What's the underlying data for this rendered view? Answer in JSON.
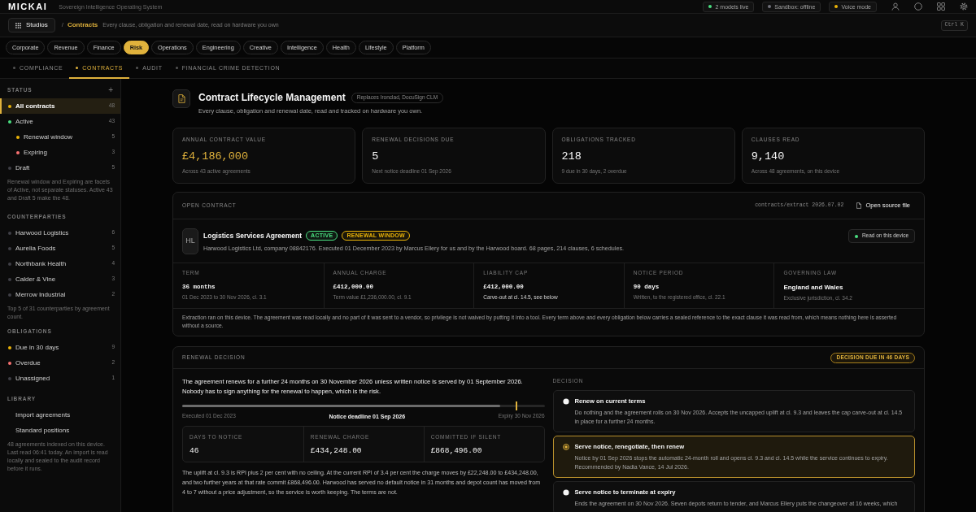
{
  "top_bar": {
    "logo": "MICKAI",
    "tagline": "Sovereign Intelligence Operating System",
    "status_pills": [
      {
        "label": "2 models live",
        "color": "#4ade80"
      },
      {
        "label": "Sandbox: offline",
        "color": "#71717a"
      },
      {
        "label": "Voice mode",
        "color": "#eab308"
      }
    ]
  },
  "breadcrumb": {
    "studios_button": "Studios",
    "separator": "/",
    "current": "Contracts",
    "description": "Every clause, obligation and renewal date, read on hardware you own",
    "shortcut": "Ctrl K"
  },
  "studios": [
    {
      "label": "Corporate",
      "selected": false
    },
    {
      "label": "Revenue",
      "selected": false
    },
    {
      "label": "Finance",
      "selected": false
    },
    {
      "label": "Risk",
      "selected": true
    },
    {
      "label": "Operations",
      "selected": false
    },
    {
      "label": "Engineering",
      "selected": false
    },
    {
      "label": "Creative",
      "selected": false
    },
    {
      "label": "Intelligence",
      "selected": false
    },
    {
      "label": "Health",
      "selected": false
    },
    {
      "label": "Lifestyle",
      "selected": false
    },
    {
      "label": "Platform",
      "selected": false
    }
  ],
  "tabs": [
    {
      "label": "COMPLIANCE",
      "selected": false
    },
    {
      "label": "CONTRACTS",
      "selected": true
    },
    {
      "label": "AUDIT",
      "selected": false
    },
    {
      "label": "FINANCIAL CRIME DETECTION",
      "selected": false
    }
  ],
  "sidebar": {
    "sections": [
      {
        "title": "STATUS",
        "add_button": "+",
        "items": [
          {
            "label": "All contracts",
            "count": "48",
            "color": "#eab308",
            "selected": true
          },
          {
            "label": "Active",
            "count": "43",
            "color": "#4ade80",
            "selected": false,
            "children": [
              {
                "label": "Renewal window",
                "count": "5",
                "color": "#eab308",
                "selected": false
              },
              {
                "label": "Expiring",
                "count": "3",
                "color": "#f87171",
                "selected": false
              }
            ]
          },
          {
            "label": "Draft",
            "count": "5",
            "color": "#3f3f46",
            "selected": false
          }
        ],
        "note": "Renewal window and Expiring are facets of Active, not separate statuses. Active 43 and Draft 5 make the 48."
      },
      {
        "title": "COUNTERPARTIES",
        "items": [
          {
            "label": "Harwood Logistics",
            "count": "6",
            "color": "#3f3f46",
            "selected": false
          },
          {
            "label": "Aurelia Foods",
            "count": "5",
            "color": "#3f3f46",
            "selected": false
          },
          {
            "label": "Northbank Health",
            "count": "4",
            "color": "#3f3f46",
            "selected": false
          },
          {
            "label": "Calder & Vine",
            "count": "3",
            "color": "#3f3f46",
            "selected": false
          },
          {
            "label": "Merrow Industrial",
            "count": "2",
            "color": "#3f3f46",
            "selected": false
          }
        ],
        "note": "Top 5 of 31 counterparties by agreement count."
      },
      {
        "title": "OBLIGATIONS",
        "items": [
          {
            "label": "Due in 30 days",
            "count": "9",
            "color": "#eab308",
            "selected": false
          },
          {
            "label": "Overdue",
            "count": "2",
            "color": "#f87171",
            "selected": false
          },
          {
            "label": "Unassigned",
            "count": "1",
            "color": "#3f3f46",
            "selected": false
          }
        ]
      },
      {
        "title": "LIBRARY",
        "items": [
          {
            "label": "Import agreements",
            "selected": false
          },
          {
            "label": "Standard positions",
            "selected": false
          }
        ],
        "note": "48 agreements indexed on this device. Last read 06:41 today. An import is read locally and sealed to the audit record before it runs."
      }
    ]
  },
  "header": {
    "title": "Contract Lifecycle Management",
    "badge": "Replaces Ironclad, DocuSign CLM",
    "subtitle": "Every clause, obligation and renewal date, read and tracked on hardware you own."
  },
  "stats": [
    {
      "label": "ANNUAL CONTRACT VALUE",
      "value": "£4,186,000",
      "note": "Across 43 active agreements",
      "highlight": true
    },
    {
      "label": "RENEWAL DECISIONS DUE",
      "value": "5",
      "note": "Next notice deadline 01 Sep 2026",
      "highlight": false
    },
    {
      "label": "OBLIGATIONS TRACKED",
      "value": "218",
      "note": "9 due in 30 days, 2 overdue",
      "highlight": false
    },
    {
      "label": "CLAUSES READ",
      "value": "9,140",
      "note": "Across 48 agreements, on this device",
      "highlight": false
    }
  ],
  "open_contract": {
    "title": "OPEN CONTRACT",
    "source": "contracts/extract 2026.07.02",
    "open_button": "Open source file",
    "avatar": "HL",
    "name": "Logistics Services Agreement",
    "badges": [
      {
        "label": "ACTIVE",
        "color": "#4ade80"
      },
      {
        "label": "RENEWAL WINDOW",
        "color": "#eab308"
      }
    ],
    "description": "Harwood Logistics Ltd, company 08842176. Executed 01 December 2023 by Marcus Ellery for us and by the Harwood board. 68 pages, 214 clauses, 6 schedules.",
    "device_status": "Read on this device",
    "terms": [
      {
        "label": "TERM",
        "value": "36 months",
        "note": "01 Dec 2023 to 30 Nov 2026, cl. 3.1",
        "kind": "figure",
        "flagged": false
      },
      {
        "label": "ANNUAL CHARGE",
        "value": "£412,000.00",
        "note": "Term value £1,236,000.00, cl. 9.1",
        "kind": "figure",
        "flagged": false
      },
      {
        "label": "LIABILITY CAP",
        "value": "£412,000.00",
        "note": "Carve-out at cl. 14.5, see below",
        "kind": "figure",
        "flagged": true
      },
      {
        "label": "NOTICE PERIOD",
        "value": "90 days",
        "note": "Written, to the registered office, cl. 22.1",
        "kind": "figure",
        "flagged": false
      },
      {
        "label": "GOVERNING LAW",
        "value": "England and Wales",
        "note": "Exclusive jurisdiction, cl. 34.2",
        "kind": "text",
        "flagged": false
      }
    ],
    "footnote": "Extraction ran on this device. The agreement was read locally and no part of it was sent to a vendor, so privilege is not waived by putting it into a tool. Every term above and every obligation below carries a sealed reference to the exact clause it was read from, which means nothing here is asserted without a source."
  },
  "renewal_decision": {
    "title": "RENEWAL DECISION",
    "due_badge": "DECISION DUE IN 46 DAYS",
    "summary": "The agreement renews for a further 24 months on 30 November 2026 unless written notice is served by 01 September 2026. Nobody has to sign anything for the renewal to happen, which is the risk.",
    "timeline": {
      "level": 0.877,
      "start": "Executed 01 Dec 2023",
      "marker_label": "Notice deadline 01 Sep 2026",
      "end": "Expiry 30 Nov 2026"
    },
    "figures": [
      {
        "label": "DAYS TO NOTICE",
        "value": "46"
      },
      {
        "label": "RENEWAL CHARGE",
        "value": "£434,248.00"
      },
      {
        "label": "COMMITTED IF SILENT",
        "value": "£868,496.00"
      }
    ],
    "analysis": "The uplift at cl. 9.3 is RPI plus 2 per cent with no ceiling. At the current RPI of 3.4 per cent the charge moves by £22,248.00 to £434,248.00, and two further years at that rate commit £868,496.00. Harwood has served no default notice in 31 months and depot count has moved from 4 to 7 without a price adjustment, so the service is worth keeping. The terms are not.",
    "decision": {
      "title": "DECISION",
      "options": [
        {
          "label": "Renew on current terms",
          "description": "Do nothing and the agreement rolls on 30 Nov 2026. Accepts the uncapped uplift at cl. 9.3 and leaves the cap carve-out at cl. 14.5 in place for a further 24 months.",
          "selected": false
        },
        {
          "label": "Serve notice, renegotiate, then renew",
          "description": "Notice by 01 Sep 2026 stops the automatic 24-month roll and opens cl. 9.3 and cl. 14.5 while the service continues to expiry. Recommended by Nadia Vance, 14 Jul 2026.",
          "selected": true
        },
        {
          "label": "Serve notice to terminate at expiry",
          "description": "Ends the agreement on 30 Nov 2026. Seven depots return to tender, and Marcus Ellery puts the changeover at 16 weeks, which",
          "selected": false
        }
      ]
    }
  }
}
